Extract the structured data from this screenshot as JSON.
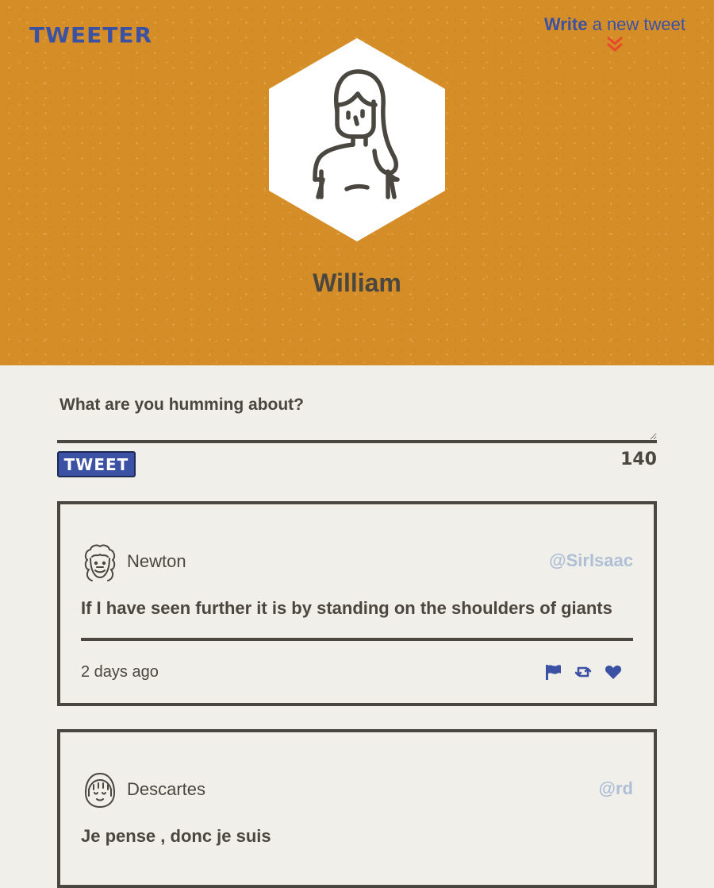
{
  "header": {
    "logo": "TWEETER",
    "write_strong": "Write",
    "write_rest": " a new tweet",
    "username": "William"
  },
  "compose": {
    "placeholder": "What are you humming about?",
    "tweet_button": "TWEET",
    "counter": "140"
  },
  "tweets": [
    {
      "name": "Newton",
      "handle": "@SirIsaac",
      "text": "If I have seen further it is by standing on the shoulders of giants",
      "time": "2 days ago",
      "avatar_icon": "curly-hair-man-avatar-icon"
    },
    {
      "name": "Descartes",
      "handle": "@rd",
      "text": "Je pense , donc je suis",
      "avatar_icon": "bob-hair-avatar-icon"
    }
  ],
  "colors": {
    "header_bg": "#d58d27",
    "accent_blue": "#3b51a3",
    "chevron_red": "#e8492a",
    "text_dark": "#4a4640",
    "handle_gray": "#aebfd6",
    "page_bg": "#f1efe9"
  }
}
